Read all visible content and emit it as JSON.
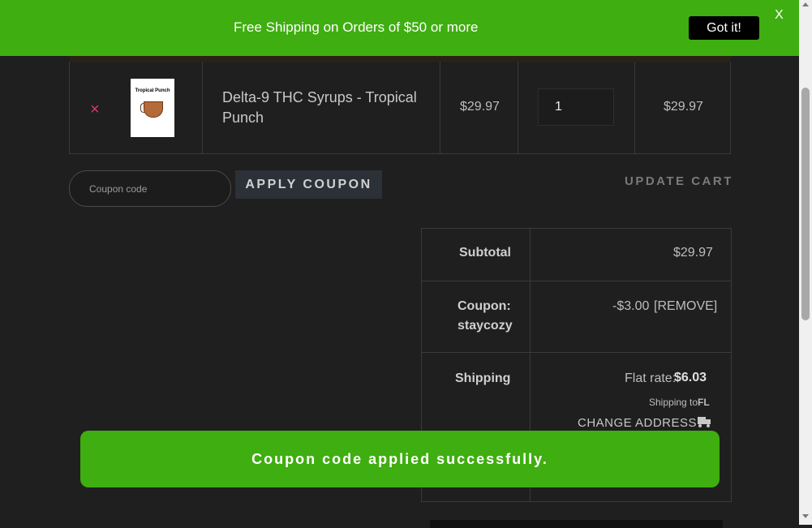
{
  "banner": {
    "text": "Free Shipping on Orders of $50 or more",
    "button": "Got it!",
    "close": "X"
  },
  "cart": {
    "item": {
      "remove_icon": "×",
      "thumb_label": "Tropical Punch",
      "name": "Delta-9 THC Syrups - Tropical Punch",
      "price": "$29.97",
      "quantity": "1",
      "subtotal": "$29.97"
    }
  },
  "coupon": {
    "placeholder": "Coupon code",
    "apply_label": "APPLY COUPON",
    "update_label": "UPDATE CART"
  },
  "totals": {
    "subtotal_label": "Subtotal",
    "subtotal_value": "$29.97",
    "coupon_label_line1": "Coupon:",
    "coupon_label_line2": "staycozy",
    "coupon_value": "-$3.00",
    "coupon_remove": "[REMOVE]",
    "shipping_label": "Shipping",
    "shipping_rate_prefix": "Flat rate:",
    "shipping_rate_value": "$6.03",
    "shipping_to_prefix": "Shipping to",
    "shipping_to_state": "FL",
    "change_address": "CHANGE ADDRESS"
  },
  "toast": {
    "message": "Coupon code applied successfully."
  },
  "colors": {
    "accent_green": "#3fae10",
    "remove_red": "#e03561",
    "background": "#1f1f1f"
  },
  "icons": {
    "remove": "close-icon",
    "truck": "truck-icon"
  }
}
